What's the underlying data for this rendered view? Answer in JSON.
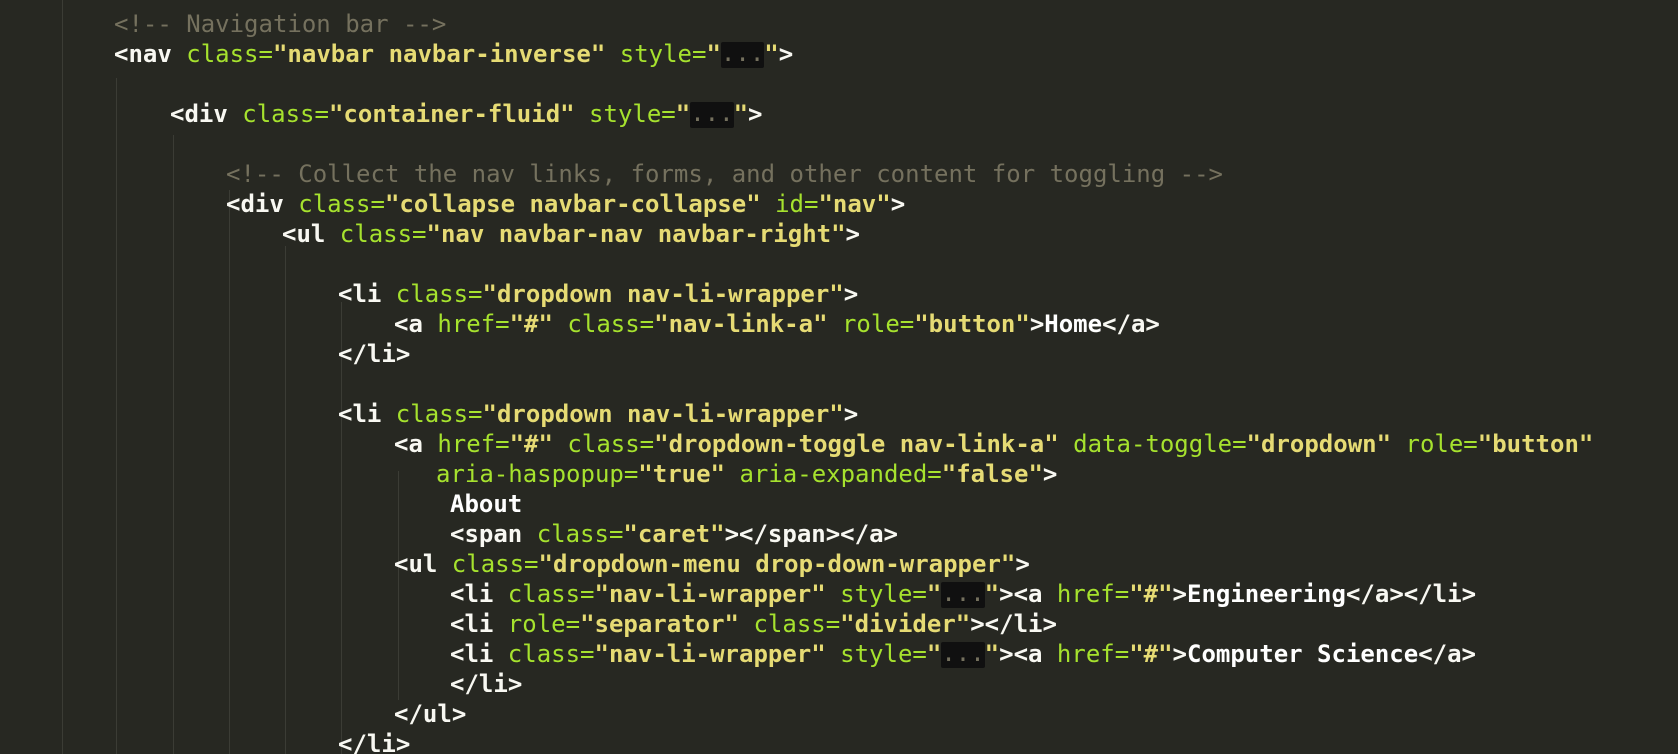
{
  "editor": {
    "theme_colors": {
      "background": "#272822",
      "comment": "#75715e",
      "tag": "#f8f8f2",
      "attribute": "#a6e22e",
      "string": "#e6db74",
      "text": "#ffffff",
      "fold_marker_bg": "#101010"
    },
    "fold_marker": "...",
    "lines": [
      {
        "indent": 0,
        "tokens": [
          {
            "t": "c",
            "v": "<!-- Navigation bar -->"
          }
        ]
      },
      {
        "indent": 0,
        "tokens": [
          {
            "t": "b",
            "v": "<"
          },
          {
            "t": "t",
            "v": "nav"
          },
          {
            "t": "a",
            "v": " class="
          },
          {
            "t": "s",
            "v": "\"navbar navbar-inverse\""
          },
          {
            "t": "a",
            "v": " style="
          },
          {
            "t": "s",
            "v": "\""
          },
          {
            "t": "fold",
            "v": "..."
          },
          {
            "t": "s",
            "v": "\""
          },
          {
            "t": "b",
            "v": ">"
          }
        ]
      },
      {
        "indent": 0,
        "tokens": []
      },
      {
        "indent": 1,
        "tokens": [
          {
            "t": "b",
            "v": "<"
          },
          {
            "t": "t",
            "v": "div"
          },
          {
            "t": "a",
            "v": " class="
          },
          {
            "t": "s",
            "v": "\"container-fluid\""
          },
          {
            "t": "a",
            "v": " style="
          },
          {
            "t": "s",
            "v": "\""
          },
          {
            "t": "fold",
            "v": "..."
          },
          {
            "t": "s",
            "v": "\""
          },
          {
            "t": "b",
            "v": ">"
          }
        ]
      },
      {
        "indent": 0,
        "tokens": []
      },
      {
        "indent": 2,
        "tokens": [
          {
            "t": "c",
            "v": "<!-- Collect the nav links, forms, and other content for toggling -->"
          }
        ]
      },
      {
        "indent": 2,
        "tokens": [
          {
            "t": "b",
            "v": "<"
          },
          {
            "t": "t",
            "v": "div"
          },
          {
            "t": "a",
            "v": " class="
          },
          {
            "t": "s",
            "v": "\"collapse navbar-collapse\""
          },
          {
            "t": "a",
            "v": " id="
          },
          {
            "t": "s",
            "v": "\"nav\""
          },
          {
            "t": "b",
            "v": ">"
          }
        ]
      },
      {
        "indent": 3,
        "tokens": [
          {
            "t": "b",
            "v": "<"
          },
          {
            "t": "t",
            "v": "ul"
          },
          {
            "t": "a",
            "v": " class="
          },
          {
            "t": "s",
            "v": "\"nav navbar-nav navbar-right\""
          },
          {
            "t": "b",
            "v": ">"
          }
        ]
      },
      {
        "indent": 0,
        "tokens": []
      },
      {
        "indent": 4,
        "tokens": [
          {
            "t": "b",
            "v": "<"
          },
          {
            "t": "t",
            "v": "li"
          },
          {
            "t": "a",
            "v": " class="
          },
          {
            "t": "s",
            "v": "\"dropdown nav-li-wrapper\""
          },
          {
            "t": "b",
            "v": ">"
          }
        ]
      },
      {
        "indent": 5,
        "tokens": [
          {
            "t": "b",
            "v": "<"
          },
          {
            "t": "t",
            "v": "a"
          },
          {
            "t": "a",
            "v": " href="
          },
          {
            "t": "s",
            "v": "\"#\""
          },
          {
            "t": "a",
            "v": " class="
          },
          {
            "t": "s",
            "v": "\"nav-link-a\""
          },
          {
            "t": "a",
            "v": " role="
          },
          {
            "t": "s",
            "v": "\"button\""
          },
          {
            "t": "b",
            "v": ">"
          },
          {
            "t": "tx",
            "v": "Home"
          },
          {
            "t": "b",
            "v": "</"
          },
          {
            "t": "t",
            "v": "a"
          },
          {
            "t": "b",
            "v": ">"
          }
        ]
      },
      {
        "indent": 4,
        "tokens": [
          {
            "t": "b",
            "v": "</"
          },
          {
            "t": "t",
            "v": "li"
          },
          {
            "t": "b",
            "v": ">"
          }
        ]
      },
      {
        "indent": 0,
        "tokens": []
      },
      {
        "indent": 4,
        "tokens": [
          {
            "t": "b",
            "v": "<"
          },
          {
            "t": "t",
            "v": "li"
          },
          {
            "t": "a",
            "v": " class="
          },
          {
            "t": "s",
            "v": "\"dropdown nav-li-wrapper\""
          },
          {
            "t": "b",
            "v": ">"
          }
        ]
      },
      {
        "indent": 5,
        "tokens": [
          {
            "t": "b",
            "v": "<"
          },
          {
            "t": "t",
            "v": "a"
          },
          {
            "t": "a",
            "v": " href="
          },
          {
            "t": "s",
            "v": "\"#\""
          },
          {
            "t": "a",
            "v": " class="
          },
          {
            "t": "s",
            "v": "\"dropdown-toggle nav-link-a\""
          },
          {
            "t": "a",
            "v": " data-toggle="
          },
          {
            "t": "s",
            "v": "\"dropdown\""
          },
          {
            "t": "a",
            "v": " role="
          },
          {
            "t": "s",
            "v": "\"button\""
          }
        ]
      },
      {
        "indent": 5,
        "extra": 3,
        "tokens": [
          {
            "t": "a",
            "v": "aria-haspopup="
          },
          {
            "t": "s",
            "v": "\"true\""
          },
          {
            "t": "a",
            "v": " aria-expanded="
          },
          {
            "t": "s",
            "v": "\"false\""
          },
          {
            "t": "b",
            "v": ">"
          }
        ]
      },
      {
        "indent": 6,
        "tokens": [
          {
            "t": "tx",
            "v": "About"
          }
        ]
      },
      {
        "indent": 6,
        "tokens": [
          {
            "t": "b",
            "v": "<"
          },
          {
            "t": "t",
            "v": "span"
          },
          {
            "t": "a",
            "v": " class="
          },
          {
            "t": "s",
            "v": "\"caret\""
          },
          {
            "t": "b",
            "v": "></"
          },
          {
            "t": "t",
            "v": "span"
          },
          {
            "t": "b",
            "v": "></"
          },
          {
            "t": "t",
            "v": "a"
          },
          {
            "t": "b",
            "v": ">"
          }
        ]
      },
      {
        "indent": 5,
        "tokens": [
          {
            "t": "b",
            "v": "<"
          },
          {
            "t": "t",
            "v": "ul"
          },
          {
            "t": "a",
            "v": " class="
          },
          {
            "t": "s",
            "v": "\"dropdown-menu drop-down-wrapper\""
          },
          {
            "t": "b",
            "v": ">"
          }
        ]
      },
      {
        "indent": 6,
        "tokens": [
          {
            "t": "b",
            "v": "<"
          },
          {
            "t": "t",
            "v": "li"
          },
          {
            "t": "a",
            "v": " class="
          },
          {
            "t": "s",
            "v": "\"nav-li-wrapper\""
          },
          {
            "t": "a",
            "v": " style="
          },
          {
            "t": "s",
            "v": "\""
          },
          {
            "t": "fold",
            "v": "..."
          },
          {
            "t": "s",
            "v": "\""
          },
          {
            "t": "b",
            "v": "><"
          },
          {
            "t": "t",
            "v": "a"
          },
          {
            "t": "a",
            "v": " href="
          },
          {
            "t": "s",
            "v": "\"#\""
          },
          {
            "t": "b",
            "v": ">"
          },
          {
            "t": "tx",
            "v": "Engineering"
          },
          {
            "t": "b",
            "v": "</"
          },
          {
            "t": "t",
            "v": "a"
          },
          {
            "t": "b",
            "v": "></"
          },
          {
            "t": "t",
            "v": "li"
          },
          {
            "t": "b",
            "v": ">"
          }
        ]
      },
      {
        "indent": 6,
        "tokens": [
          {
            "t": "b",
            "v": "<"
          },
          {
            "t": "t",
            "v": "li"
          },
          {
            "t": "a",
            "v": " role="
          },
          {
            "t": "s",
            "v": "\"separator\""
          },
          {
            "t": "a",
            "v": " class="
          },
          {
            "t": "s",
            "v": "\"divider\""
          },
          {
            "t": "b",
            "v": "></"
          },
          {
            "t": "t",
            "v": "li"
          },
          {
            "t": "b",
            "v": ">"
          }
        ]
      },
      {
        "indent": 6,
        "tokens": [
          {
            "t": "b",
            "v": "<"
          },
          {
            "t": "t",
            "v": "li"
          },
          {
            "t": "a",
            "v": " class="
          },
          {
            "t": "s",
            "v": "\"nav-li-wrapper\""
          },
          {
            "t": "a",
            "v": " style="
          },
          {
            "t": "s",
            "v": "\""
          },
          {
            "t": "fold",
            "v": "..."
          },
          {
            "t": "s",
            "v": "\""
          },
          {
            "t": "b",
            "v": "><"
          },
          {
            "t": "t",
            "v": "a"
          },
          {
            "t": "a",
            "v": " href="
          },
          {
            "t": "s",
            "v": "\"#\""
          },
          {
            "t": "b",
            "v": ">"
          },
          {
            "t": "tx",
            "v": "Computer Science"
          },
          {
            "t": "b",
            "v": "</"
          },
          {
            "t": "t",
            "v": "a"
          },
          {
            "t": "b",
            "v": ">"
          }
        ]
      },
      {
        "indent": 6,
        "tokens": [
          {
            "t": "b",
            "v": "</"
          },
          {
            "t": "t",
            "v": "li"
          },
          {
            "t": "b",
            "v": ">"
          }
        ]
      },
      {
        "indent": 5,
        "tokens": [
          {
            "t": "b",
            "v": "</"
          },
          {
            "t": "t",
            "v": "ul"
          },
          {
            "t": "b",
            "v": ">"
          }
        ]
      },
      {
        "indent": 4,
        "tokens": [
          {
            "t": "b",
            "v": "</"
          },
          {
            "t": "t",
            "v": "li"
          },
          {
            "t": "b",
            "v": ">"
          }
        ]
      }
    ]
  }
}
